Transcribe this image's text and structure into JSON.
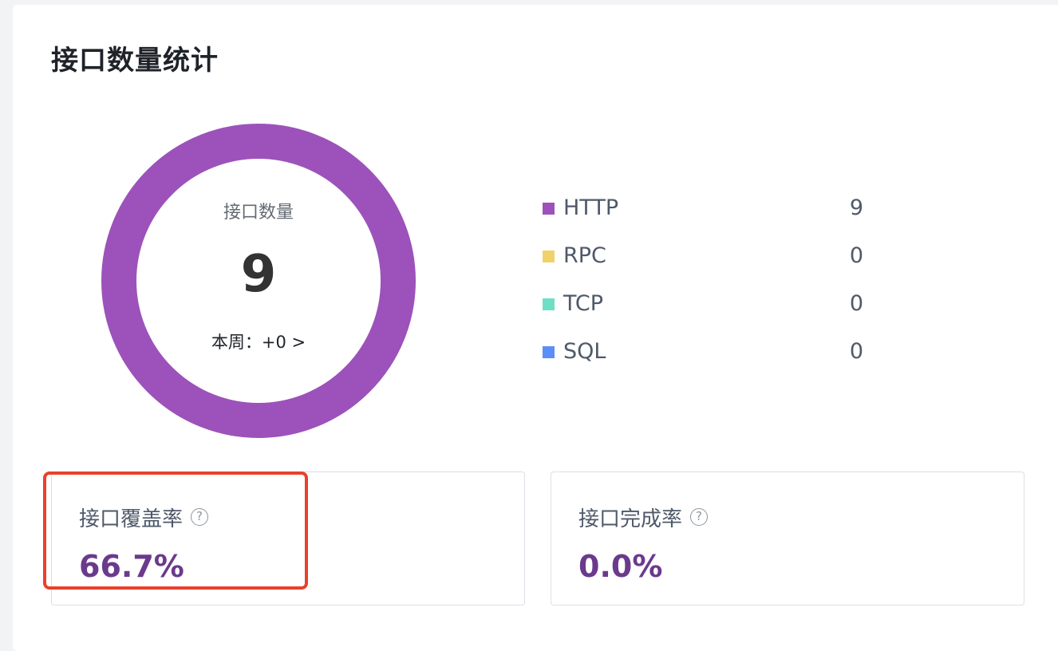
{
  "card": {
    "title": "接口数量统计"
  },
  "donut": {
    "label": "接口数量",
    "total": "9",
    "week_text": "本周：+0 >",
    "ring_color": "#9c52ba"
  },
  "legend": [
    {
      "name": "HTTP",
      "count": "9",
      "color": "#9c52ba"
    },
    {
      "name": "RPC",
      "count": "0",
      "color": "#f0d26a"
    },
    {
      "name": "TCP",
      "count": "0",
      "color": "#6edfc6"
    },
    {
      "name": "SQL",
      "count": "0",
      "color": "#5b8ef6"
    }
  ],
  "stats": {
    "coverage": {
      "title": "接口覆盖率",
      "value": "66.7%",
      "help_icon": "question-circle-icon"
    },
    "completion": {
      "title": "接口完成率",
      "value": "0.0%",
      "help_icon": "question-circle-icon"
    },
    "value_color": "#6b3a8c"
  },
  "highlight": {
    "color": "#e8412c"
  }
}
